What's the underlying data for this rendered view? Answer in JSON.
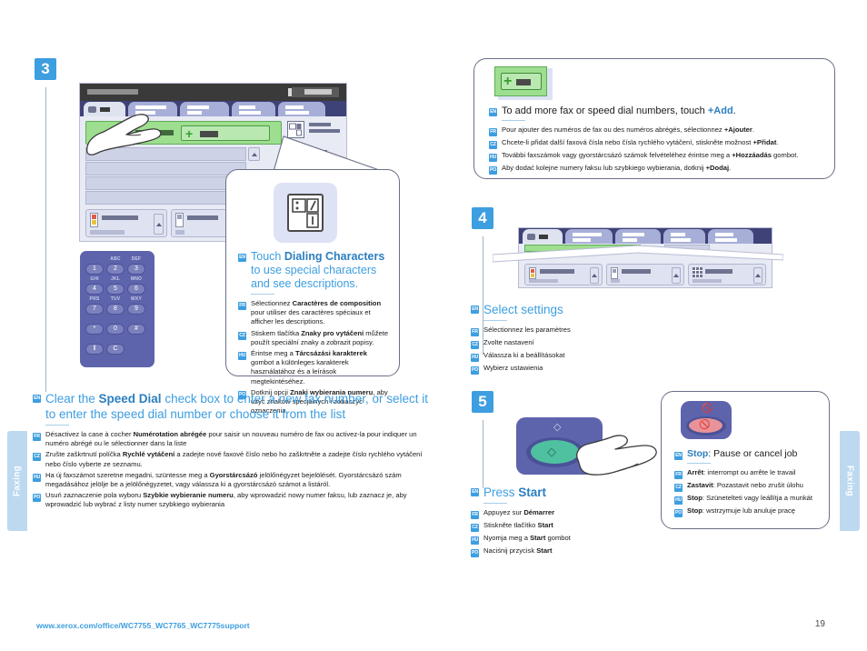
{
  "document": {
    "footer_url": "www.xerox.com/office/WC7755_WC7765_WC7775support",
    "page_number": "19",
    "side_tab_left": "Faxing",
    "side_tab_right": "Faxing"
  },
  "lang_codes": {
    "en": "EN",
    "fr": "FR",
    "cz": "CZ",
    "hu": "HU",
    "po": "PO"
  },
  "colors": {
    "accent_blue": "#3d9ee0",
    "badge_blue": "#3d9ee0",
    "keypad_purple": "#5e64ac",
    "start_green": "#4fc0a0",
    "stop_red": "#e8929a",
    "side_tab": "#bcd9f0"
  },
  "steps": {
    "step3": {
      "number": "3",
      "callout_dialing": {
        "en": {
          "pre": "Touch ",
          "bold": "Dialing Characters",
          "post": " to use special characters and see descriptions."
        },
        "fr": {
          "pre": "Sélectionnez ",
          "bold": "Caractères de composition",
          "post": " pour utiliser des caractères spéciaux et afficher les descriptions."
        },
        "cz": {
          "pre": "Stiskem tlačítka ",
          "bold": "Znaky pro vytáčení",
          "post": " můžete použít speciální znaky a zobrazit popisy."
        },
        "hu": {
          "pre": "Érintse meg a ",
          "bold": "Tárcsázási karakterek",
          "post": " gombot a különleges karakterek használatához és a leírások megtekintéséhez."
        },
        "po": {
          "pre": "Dotknij opcji ",
          "bold": "Znaki wybierania numeru",
          "post": ", aby użyć znaków specjalnych i zobaczyć oznaczenia."
        }
      },
      "speed_dial": {
        "en": {
          "pre": "Clear the ",
          "bold": "Speed Dial",
          "post": " check box to enter a new fax number, or select it to enter the speed dial number or choose it from the list"
        },
        "fr": {
          "pre": "Désactivez la case à cocher ",
          "bold": "Numérotation abrégée",
          "post": " pour saisir un nouveau numéro de fax ou activez-la pour indiquer un numéro abrégé ou le sélectionner dans la liste"
        },
        "cz": {
          "pre": "Zrušte zaškrtnutí políčka ",
          "bold": "Rychlé vytáčení",
          "post": " a zadejte nové faxové číslo nebo ho zaškrtněte a zadejte číslo rychlého vytáčení nebo číslo vyberte ze seznamu."
        },
        "hu": {
          "pre": "Ha új faxszámot szeretne megadni, szüntesse meg a ",
          "bold": "Gyorstárcsázó",
          "post": " jelölőnégyzet bejelölését. Gyorstárcsázó szám megadásához jelölje be a jelölőnégyzetet, vagy válassza ki a gyorstárcsázó számot a listáról."
        },
        "po": {
          "pre": "Usuń zaznaczenie pola wyboru ",
          "bold": "Szybkie wybieranie numeru",
          "post": ", aby wprowadzić nowy numer faksu, lub zaznacz je, aby wprowadzić lub wybrać z listy numer szybkiego wybierania"
        }
      },
      "keypad": {
        "keys": [
          {
            "digit": "1",
            "letters": ""
          },
          {
            "digit": "2",
            "letters": "ABC"
          },
          {
            "digit": "3",
            "letters": "DEF"
          },
          {
            "digit": "4",
            "letters": "GHI"
          },
          {
            "digit": "5",
            "letters": "JKL"
          },
          {
            "digit": "6",
            "letters": "MNO"
          },
          {
            "digit": "7",
            "letters": "PRS"
          },
          {
            "digit": "8",
            "letters": "TUV"
          },
          {
            "digit": "9",
            "letters": "WXY"
          },
          {
            "digit": "*",
            "letters": ""
          },
          {
            "digit": "0",
            "letters": ""
          },
          {
            "digit": "#",
            "letters": ""
          },
          {
            "digit": "‖",
            "letters": ""
          },
          {
            "digit": "C",
            "letters": ""
          }
        ]
      }
    },
    "add_numbers_callout": {
      "en": {
        "pre": "To add more fax or speed dial  numbers, touch ",
        "bold": "+Add",
        "post": "."
      },
      "fr": {
        "pre": "Pour ajouter des numéros de fax ou des numéros abrégés, sélectionnez ",
        "bold": "+Ajouter",
        "post": "."
      },
      "cz": {
        "pre": "Chcete-li přidat další faxová čísla nebo čísla rychlého vytáčení, stiskněte možnost ",
        "bold": "+Přidat",
        "post": "."
      },
      "hu": {
        "pre": "További faxszámok vagy gyorstárcsázó számok felvételéhez érintse meg a ",
        "bold": "+Hozzáadás",
        "post": " gombot."
      },
      "po": {
        "pre": "Aby dodać kolejne numery faksu lub szybkiego wybierania, dotknij ",
        "bold": "+Dodaj",
        "post": "."
      }
    },
    "step4": {
      "number": "4",
      "select_settings": {
        "en": {
          "pre": "",
          "bold": "",
          "post": "Select settings"
        },
        "fr": {
          "pre": "Sélectionnez les paramètres",
          "bold": "",
          "post": ""
        },
        "cz": {
          "pre": "Zvolte nastavení",
          "bold": "",
          "post": ""
        },
        "hu": {
          "pre": "Válassza ki a beállításokat",
          "bold": "",
          "post": ""
        },
        "po": {
          "pre": "Wybierz ustawienia",
          "bold": "",
          "post": ""
        }
      }
    },
    "step5": {
      "number": "5",
      "press_start": {
        "en": {
          "pre": "Press ",
          "bold": "Start",
          "post": ""
        },
        "fr": {
          "pre": "Appuyez sur ",
          "bold": "Démarrer",
          "post": ""
        },
        "cz": {
          "pre": "Stiskněte tlačítko ",
          "bold": "Start",
          "post": ""
        },
        "hu": {
          "pre": "Nyomja meg a ",
          "bold": "Start",
          "post": " gombot"
        },
        "po": {
          "pre": "Naciśnij przycisk ",
          "bold": "Start",
          "post": ""
        }
      },
      "stop_callout": {
        "en": {
          "pre": "",
          "bold": "Stop",
          "post": ": Pause or cancel job"
        },
        "fr": {
          "pre": "",
          "bold": "Arrêt",
          "post": ": interrompt ou arrête le travail"
        },
        "cz": {
          "pre": "",
          "bold": "Zastavit",
          "post": ": Pozastavit nebo zrušit úlohu"
        },
        "hu": {
          "pre": "",
          "bold": "Stop",
          "post": ": Szünetelteti vagy leállítja a munkát"
        },
        "po": {
          "pre": "",
          "bold": "Stop",
          "post": ": wstrzymuje lub anuluje pracę"
        }
      }
    }
  }
}
